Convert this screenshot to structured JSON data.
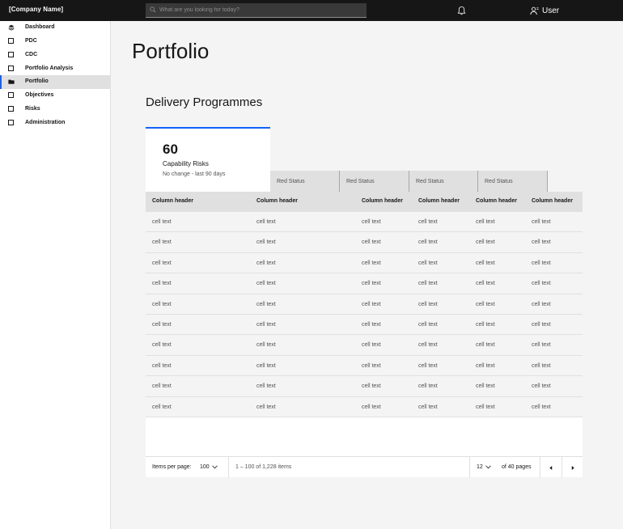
{
  "header": {
    "company": "[Company Name]",
    "search_placeholder": "What are you looking for today?",
    "user_label": "User"
  },
  "sidebar": {
    "items": [
      {
        "label": "Dashboard",
        "icon": "stack-icon"
      },
      {
        "label": "PDC",
        "icon": "checkbox-icon"
      },
      {
        "label": "CDC",
        "icon": "checkbox-icon"
      },
      {
        "label": "Portfolio Analysis",
        "icon": "checkbox-icon"
      },
      {
        "label": "Portfolio",
        "icon": "folder-open-icon",
        "active": true
      },
      {
        "label": "Objectives",
        "icon": "checkbox-icon"
      },
      {
        "label": "Risks",
        "icon": "checkbox-icon"
      },
      {
        "label": "Administration",
        "icon": "checkbox-icon"
      }
    ]
  },
  "main": {
    "page_title": "Portfolio",
    "section_title": "Delivery Programmes",
    "tile": {
      "value": "60",
      "label": "Capability Risks",
      "subtext": "No change - last 90 days"
    },
    "tabs": [
      "Red Status",
      "Red Status",
      "Red Status",
      "Red Status"
    ]
  },
  "table": {
    "headers": [
      "Column header",
      "Column header",
      "Column header",
      "Column header",
      "Column header",
      "Column header"
    ],
    "rows": [
      [
        "cell text",
        "cell text",
        "cell text",
        "cell text",
        "cell text",
        "cell text"
      ],
      [
        "cell text",
        "cell text",
        "cell text",
        "cell text",
        "cell text",
        "cell text"
      ],
      [
        "cell text",
        "cell text",
        "cell text",
        "cell text",
        "cell text",
        "cell text"
      ],
      [
        "cell text",
        "cell text",
        "cell text",
        "cell text",
        "cell text",
        "cell text"
      ],
      [
        "cell text",
        "cell text",
        "cell text",
        "cell text",
        "cell text",
        "cell text"
      ],
      [
        "cell text",
        "cell text",
        "cell text",
        "cell text",
        "cell text",
        "cell text"
      ],
      [
        "cell text",
        "cell text",
        "cell text",
        "cell text",
        "cell text",
        "cell text"
      ],
      [
        "cell text",
        "cell text",
        "cell text",
        "cell text",
        "cell text",
        "cell text"
      ],
      [
        "cell text",
        "cell text",
        "cell text",
        "cell text",
        "cell text",
        "cell text"
      ],
      [
        "cell text",
        "cell text",
        "cell text",
        "cell text",
        "cell text",
        "cell text"
      ]
    ]
  },
  "pagination": {
    "items_per_page_label": "Items per page:",
    "items_per_page_value": "100",
    "range_text": "1 – 100 of 1,228 items",
    "current_page": "12",
    "of_pages_text": "of 40 pages"
  },
  "colors": {
    "accent": "#0f62fe",
    "header_bg": "#161616",
    "surface": "#f4f4f4"
  }
}
